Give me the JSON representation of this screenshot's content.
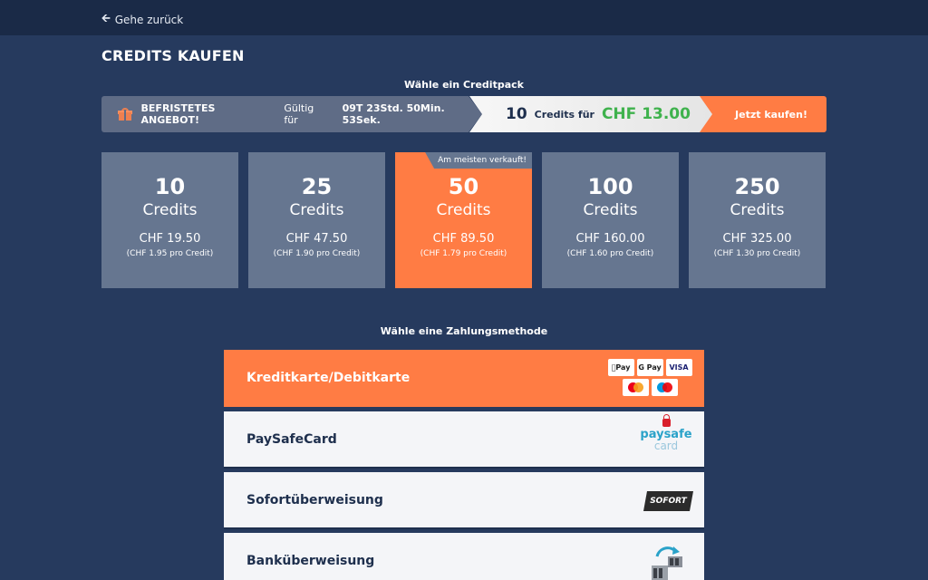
{
  "nav": {
    "back_label": "Gehe zurück",
    "back_icon": "arrow-left-icon"
  },
  "page": {
    "title": "CREDITS KAUFEN"
  },
  "creditpack_section": {
    "label": "Wähle ein Creditpack"
  },
  "offer": {
    "icon": "gift-icon",
    "title": "BEFRISTETES ANGEBOT!",
    "valid_label": "Gültig für",
    "timer": "09T 23Std. 50Min. 53Sek.",
    "credits": "10",
    "credits_for": "Credits für",
    "price": "CHF 13.00",
    "buy_label": "Jetzt kaufen!"
  },
  "packs": [
    {
      "amount": "10",
      "unit": "Credits",
      "price": "CHF 19.50",
      "per_credit": "(CHF 1.95 pro Credit)",
      "highlight": false
    },
    {
      "amount": "25",
      "unit": "Credits",
      "price": "CHF 47.50",
      "per_credit": "(CHF 1.90 pro Credit)",
      "highlight": false
    },
    {
      "amount": "50",
      "unit": "Credits",
      "price": "CHF 89.50",
      "per_credit": "(CHF 1.79 pro Credit)",
      "highlight": true,
      "badge": "Am meisten verkauft!"
    },
    {
      "amount": "100",
      "unit": "Credits",
      "price": "CHF 160.00",
      "per_credit": "(CHF 1.60 pro Credit)",
      "highlight": false
    },
    {
      "amount": "250",
      "unit": "Credits",
      "price": "CHF 325.00",
      "per_credit": "(CHF 1.30 pro Credit)",
      "highlight": false
    }
  ],
  "payment_section": {
    "label": "Wähle eine Zahlungsmethode"
  },
  "payments": [
    {
      "label": "Kreditkarte/Debitkarte",
      "active": true,
      "logos": {
        "applepay": "Pay",
        "googlepay": "G Pay",
        "visa": "VISA"
      }
    },
    {
      "label": "PaySafeCard",
      "active": false,
      "logo": {
        "line1": "paysafe",
        "line2": "card"
      }
    },
    {
      "label": "Sofortüberweisung",
      "active": false,
      "logo": "SOFORT"
    },
    {
      "label": "Banküberweisung",
      "active": false,
      "logo_icon": "bank-transfer-icon"
    }
  ],
  "colors": {
    "background": "#263a5e",
    "topbar": "#1a2a47",
    "accent": "#ff7c44",
    "pack": "#667690",
    "price_green": "#3fb24d"
  }
}
